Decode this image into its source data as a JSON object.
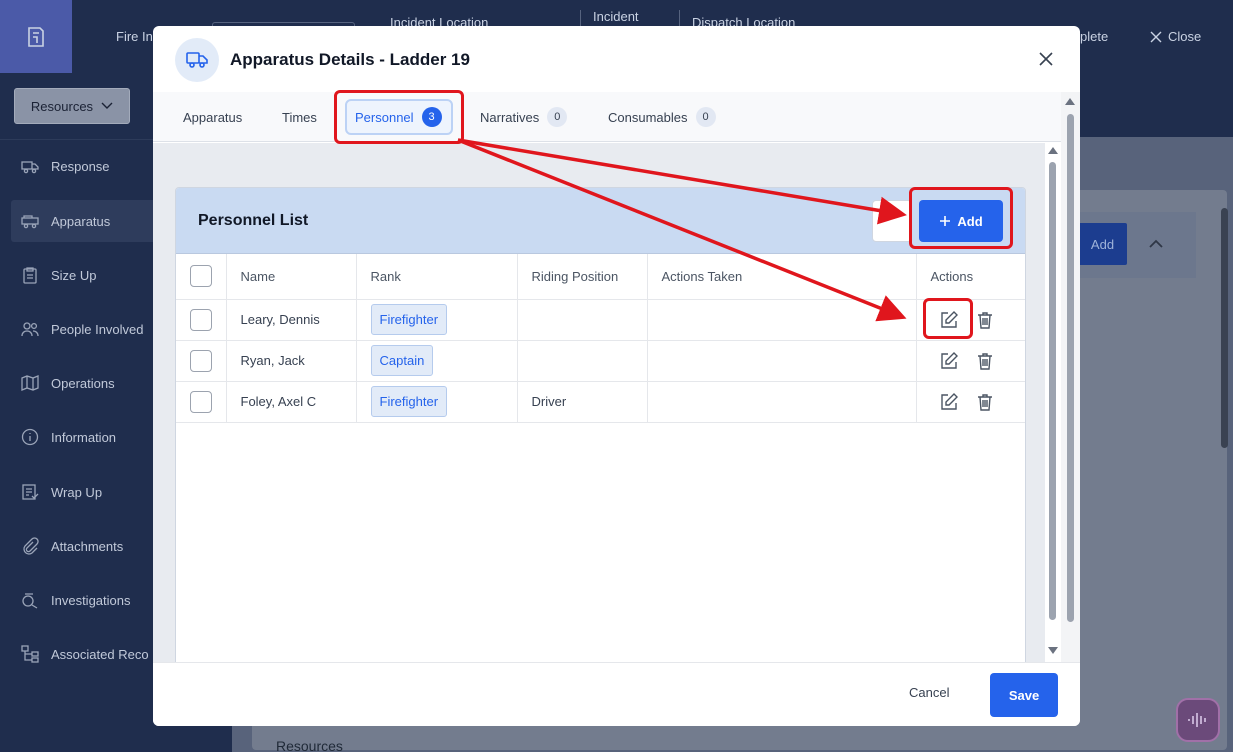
{
  "topbar": {
    "app_short": "Fire In",
    "incident_location_label": "Incident Location",
    "incident_label": "Incident",
    "dispatch_location_label": "Dispatch Location",
    "complete_label": "plete",
    "close_label": "Close"
  },
  "sidebar": {
    "resources_label": "Resources",
    "items": [
      {
        "label": "Response",
        "icon": "truck-icon"
      },
      {
        "label": "Apparatus",
        "icon": "fire-truck-icon"
      },
      {
        "label": "Size Up",
        "icon": "clipboard-icon"
      },
      {
        "label": "People Involved",
        "icon": "people-icon"
      },
      {
        "label": "Operations",
        "icon": "map-icon"
      },
      {
        "label": "Information",
        "icon": "info-icon"
      },
      {
        "label": "Wrap Up",
        "icon": "checklist-icon"
      },
      {
        "label": "Attachments",
        "icon": "paperclip-icon"
      },
      {
        "label": "Investigations",
        "icon": "magnify-icon"
      },
      {
        "label": "Associated Reco",
        "icon": "tree-icon"
      }
    ]
  },
  "background": {
    "add_label": "Add",
    "resources_section": "Resources"
  },
  "modal": {
    "title": "Apparatus Details - Ladder 19",
    "tabs": [
      {
        "label": "Apparatus",
        "badge": null
      },
      {
        "label": "Times",
        "badge": null
      },
      {
        "label": "Personnel",
        "badge": "3"
      },
      {
        "label": "Narratives",
        "badge": "0"
      },
      {
        "label": "Consumables",
        "badge": "0"
      }
    ],
    "panel": {
      "title": "Personnel List",
      "add_label": "Add",
      "columns": [
        "Name",
        "Rank",
        "Riding Position",
        "Actions Taken",
        "Actions"
      ],
      "rows": [
        {
          "name": "Leary, Dennis",
          "rank": "Firefighter",
          "riding_position": "",
          "actions_taken": ""
        },
        {
          "name": "Ryan, Jack",
          "rank": "Captain",
          "riding_position": "",
          "actions_taken": ""
        },
        {
          "name": "Foley, Axel C",
          "rank": "Firefighter",
          "riding_position": "Driver",
          "actions_taken": ""
        }
      ]
    },
    "footer": {
      "cancel_label": "Cancel",
      "save_label": "Save"
    }
  },
  "colors": {
    "accent": "#2563eb",
    "annotation": "#e0161d",
    "sidebar_bg": "#1f2d4d"
  }
}
